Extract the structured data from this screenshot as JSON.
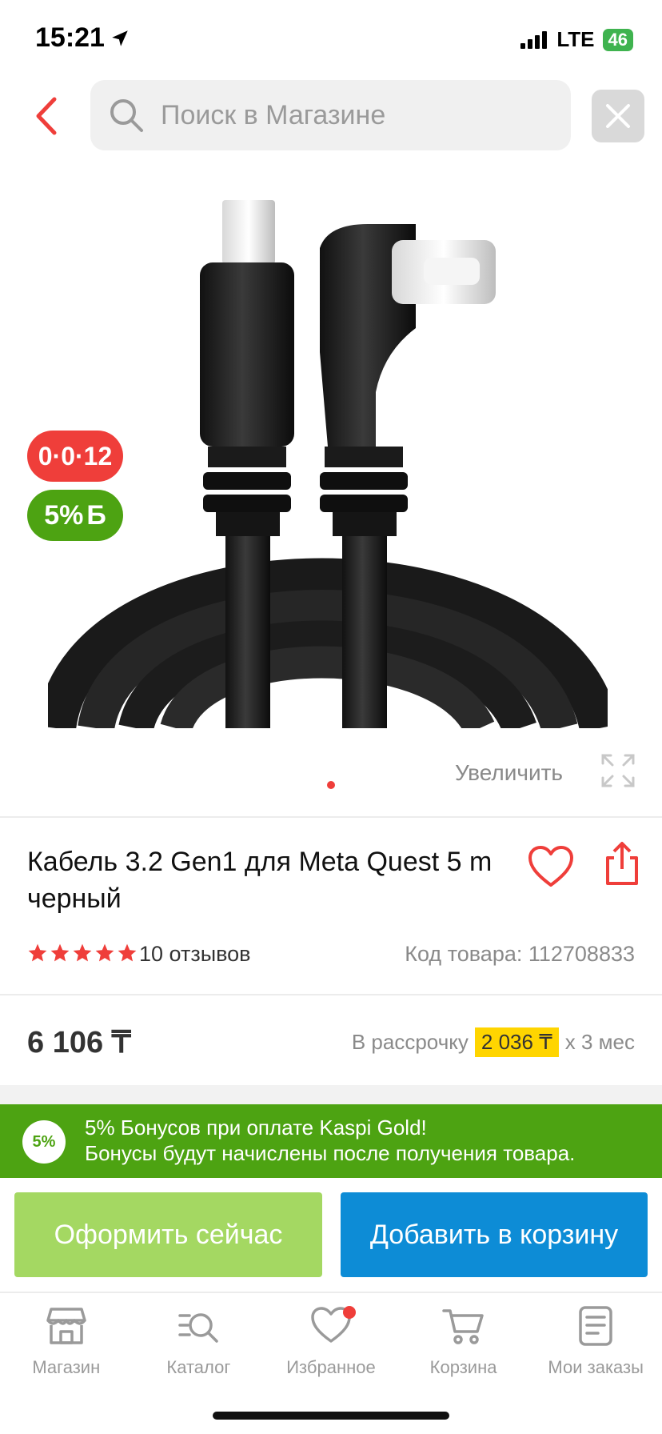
{
  "status_bar": {
    "time": "15:21",
    "network": "LTE",
    "battery": "46"
  },
  "header": {
    "search_placeholder": "Поиск в Магазине"
  },
  "badges": {
    "installment": "0·0·12",
    "bonus_percent": "5%",
    "bonus_symbol": "Б"
  },
  "gallery": {
    "zoom_label": "Увеличить"
  },
  "product": {
    "title": "Кабель 3.2 Gen1 для Meta Quest 5 m черный",
    "rating": 5,
    "reviews": "10 отзывов",
    "sku": "Код товара: 112708833",
    "price": "6 106 ₸",
    "installment_prefix": "В рассрочку",
    "installment_monthly": "2 036 ₸",
    "installment_suffix": "х 3 мес"
  },
  "promo": {
    "badge": "5%",
    "line1": "5% Бонусов при оплате Kaspi Gold!",
    "line2": "Бонусы будут начислены после получения товара."
  },
  "actions": {
    "checkout": "Оформить сейчас",
    "add_to_cart": "Добавить в корзину"
  },
  "tabbar": {
    "items": [
      {
        "label": "Магазин",
        "icon": "shop-icon"
      },
      {
        "label": "Каталог",
        "icon": "catalog-search-icon"
      },
      {
        "label": "Избранное",
        "icon": "heart-icon"
      },
      {
        "label": "Корзина",
        "icon": "cart-icon"
      },
      {
        "label": "Мои заказы",
        "icon": "orders-icon"
      }
    ]
  },
  "colors": {
    "accent_red": "#ef3e3a",
    "bonus_green": "#4da312",
    "checkout_green": "#a4d862",
    "cart_blue": "#0d8cd6",
    "installment_yellow": "#ffd500"
  }
}
